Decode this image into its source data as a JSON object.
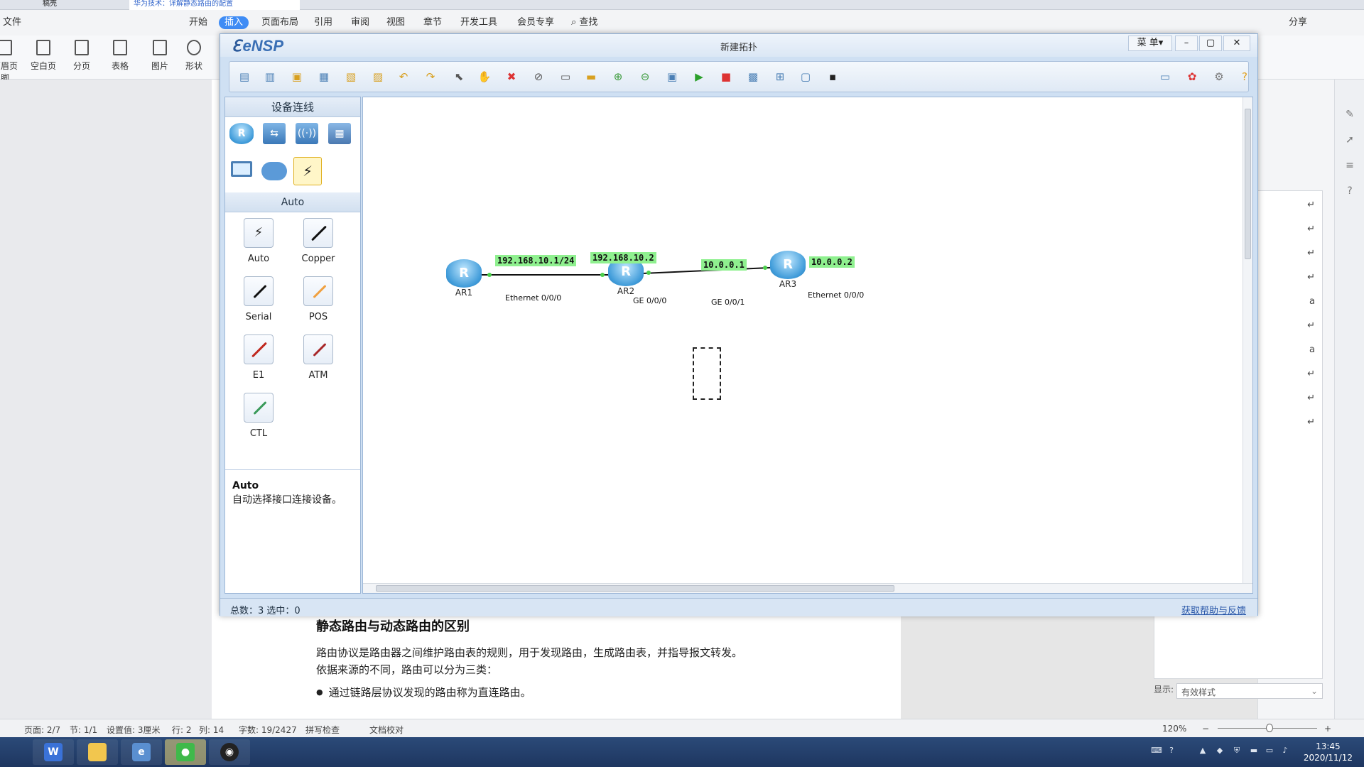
{
  "wps": {
    "tabs": [
      "稿壳",
      "华为技术：详解静态路由的配置"
    ],
    "menu": [
      "文件",
      "开始",
      "插入",
      "页面布局",
      "引用",
      "审阅",
      "视图",
      "章节",
      "开发工具",
      "会员专享",
      "查找"
    ],
    "right_menu": [
      "分享"
    ],
    "ribbon": [
      "页眉页脚",
      "空白页",
      "分页",
      "表格",
      "图片",
      "形状"
    ],
    "document": {
      "heading": "静态路由与动态路由的区别",
      "para1": "路由协议是路由器之间维护路由表的规则，用于发现路由，生成路由表，并指导报文转发。",
      "para2": "依据来源的不同，路由可以分为三类：",
      "bullet1": "通过链路层协议发现的路由称为直连路由。"
    },
    "style_display_label": "显示:",
    "style_display_value": "有效样式",
    "status": {
      "page": "页面: 2/7",
      "section": "节: 1/1",
      "setting": "设置值: 3厘米",
      "row": "行: 2",
      "col": "列: 14",
      "words": "字数: 19/2427",
      "spell": "拼写检查",
      "proof": "文档校对",
      "zoom": "120%"
    }
  },
  "ensp": {
    "app_name": "eNSP",
    "title": "新建拓扑",
    "menu_button": "菜 单▾",
    "device_panel_title": "设备连线",
    "connection_section_title": "Auto",
    "connections": [
      "Auto",
      "Copper",
      "Serial",
      "POS",
      "E1",
      "ATM",
      "CTL"
    ],
    "description": {
      "title": "Auto",
      "text": "自动选择接口连接设备。"
    },
    "topology": {
      "nodes": [
        {
          "name": "AR1"
        },
        {
          "name": "AR2"
        },
        {
          "name": "AR3"
        }
      ],
      "ip_labels": [
        "192.168.10.1/24",
        "192.168.10.2",
        "10.0.0.1",
        "10.0.0.2"
      ],
      "port_labels": [
        "Ethernet 0/0/0",
        "GE 0/0/0",
        "GE 0/0/1",
        "Ethernet 0/0/0"
      ]
    },
    "status_text": "总数：3  选中：0",
    "help_link": "获取帮助与反馈"
  },
  "taskbar": {
    "time": "13:45",
    "date": "2020/11/12"
  }
}
